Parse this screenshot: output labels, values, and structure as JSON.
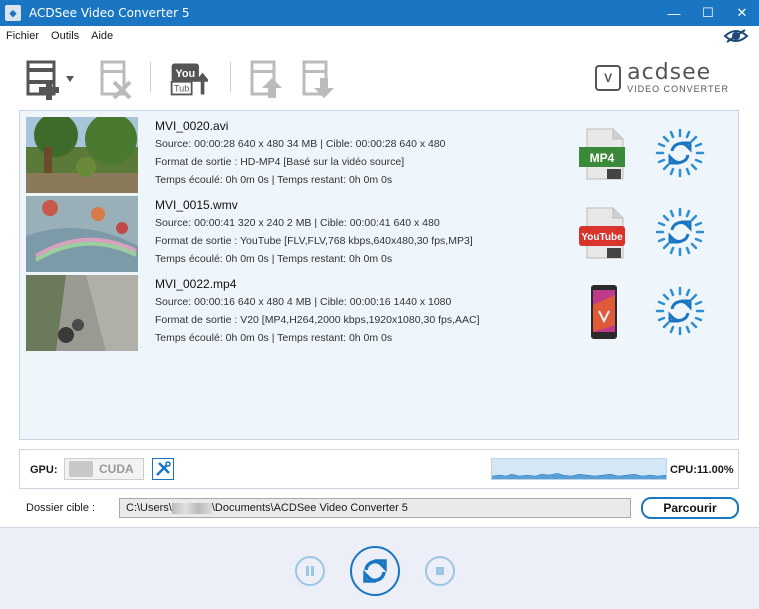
{
  "window": {
    "title": "ACDSee Video Converter 5"
  },
  "menu": {
    "items": [
      "Fichier",
      "Outils",
      "Aide"
    ]
  },
  "toolbar": {
    "buttons": [
      "add-files",
      "remove",
      "youtube-upload",
      "move-up",
      "move-down"
    ],
    "logo_brand": "acdsee",
    "logo_sub": "VIDEO CONVERTER"
  },
  "files": [
    {
      "name": "MVI_0020.avi",
      "source": "Source: 00:00:28 640 x 480 34 MB | Cible: 00:00:28 640 x 480",
      "format": "Format de sortie : HD-MP4 [Basé sur la vidéo source]",
      "time": "Temps écoulé: 0h 0m 0s | Temps restant: 0h 0m 0s",
      "format_icon": "mp4-file-icon",
      "format_icon_text": "MP4"
    },
    {
      "name": "MVI_0015.wmv",
      "source": "Source: 00:00:41 320 x 240 2 MB | Cible: 00:00:41 640 x 480",
      "format": "Format de sortie : YouTube [FLV,FLV,768 kbps,640x480,30 fps,MP3]",
      "time": "Temps écoulé: 0h 0m 0s | Temps restant: 0h 0m 0s",
      "format_icon": "youtube-file-icon",
      "format_icon_text": "YouTube"
    },
    {
      "name": "MVI_0022.mp4",
      "source": "Source: 00:00:16 640 x 480 4 MB | Cible: 00:00:16 1440 x 1080",
      "format": "Format de sortie : V20 [MP4,H264,2000 kbps,1920x1080,30 fps,AAC]",
      "time": "Temps écoulé: 0h 0m 0s | Temps restant: 0h 0m 0s",
      "format_icon": "phone-icon",
      "format_icon_text": ""
    }
  ],
  "gpu": {
    "label": "GPU:",
    "cuda_label": "CUDA",
    "cpu_label": "CPU:11.00%"
  },
  "destination": {
    "label": "Dossier cible :",
    "path_prefix": "C:\\Users\\",
    "path_suffix": "\\Documents\\ACDSee Video Converter 5",
    "browse_label": "Parcourir"
  },
  "colors": {
    "accent": "#1a76c2",
    "list_bg": "#eef5fb",
    "bottom_bg": "#eceff8"
  }
}
